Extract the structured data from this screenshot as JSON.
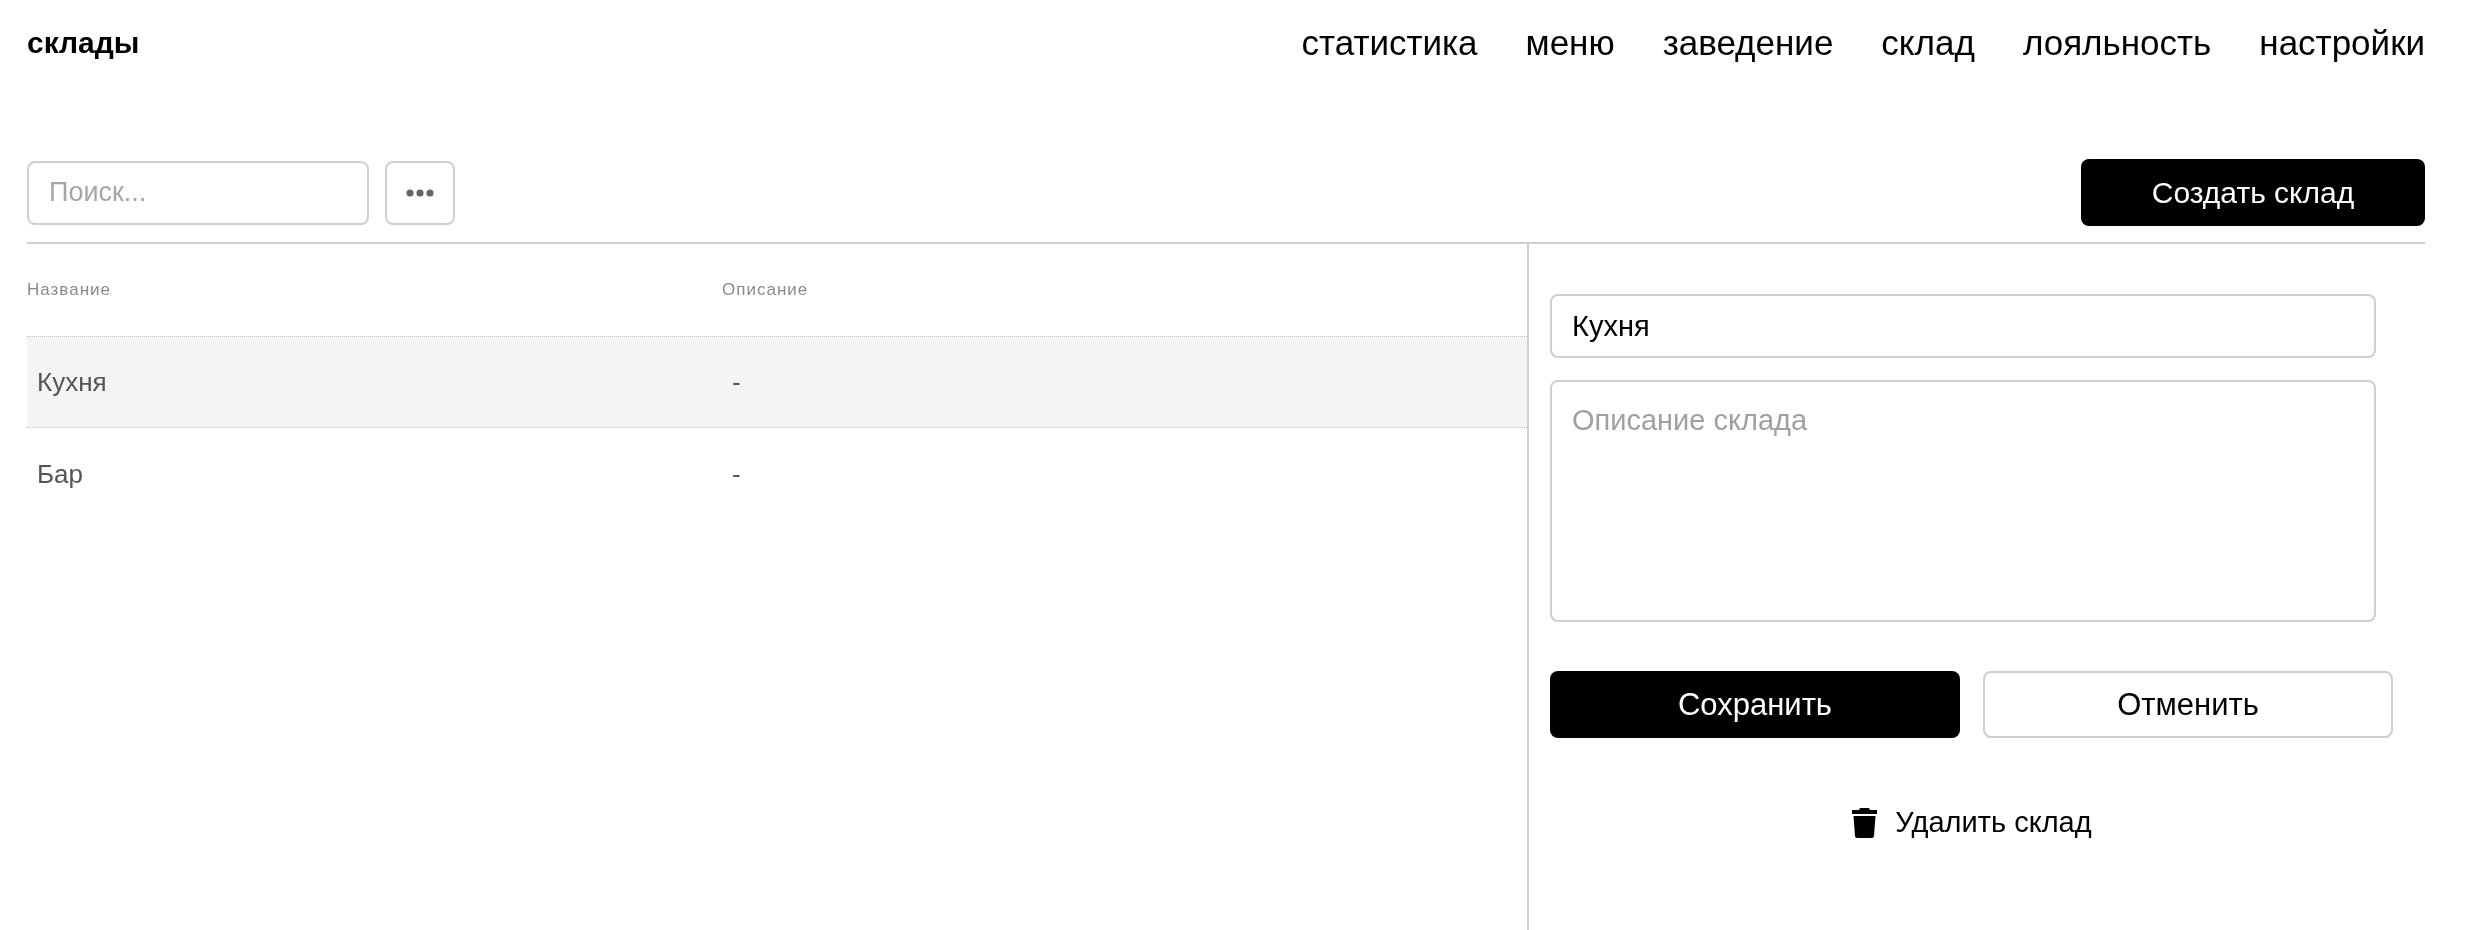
{
  "header": {
    "title": "склады",
    "nav": [
      "статистика",
      "меню",
      "заведение",
      "склад",
      "лояльность",
      "настройки"
    ]
  },
  "toolbar": {
    "search": {
      "placeholder": "Поиск..."
    },
    "create_button": "Создать склад"
  },
  "table": {
    "columns": [
      "Название",
      "Описание"
    ],
    "rows": [
      {
        "cells": [
          "Кухня",
          "-"
        ],
        "selected": true
      },
      {
        "cells": [
          "Бар",
          "-"
        ],
        "selected": false
      }
    ]
  },
  "editor": {
    "name_field": {
      "value": "Кухня"
    },
    "description_field": {
      "placeholder": "Описание склада"
    },
    "buttons": [
      {
        "label": "Сохранить",
        "kind": "primary"
      },
      {
        "label": "Отменить",
        "kind": "secondary"
      }
    ],
    "delete_link": "Удалить склад"
  }
}
